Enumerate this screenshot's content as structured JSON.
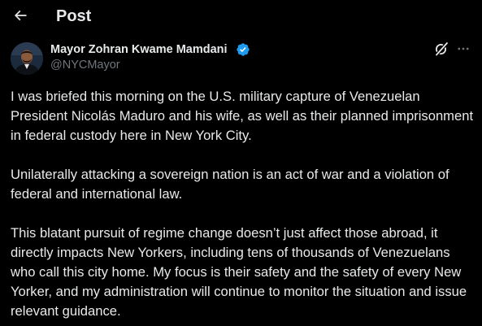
{
  "header": {
    "title": "Post"
  },
  "author": {
    "display_name": "Mayor Zohran Kwame Mamdani",
    "handle": "@NYCMayor",
    "verified": true,
    "verified_color": "#1d9bf0"
  },
  "post": {
    "paragraphs": [
      "I was briefed this morning on the U.S. military capture of Venezuelan President Nicolás Maduro and his wife, as well as their planned imprisonment in federal custody here in New York City.",
      "Unilaterally attacking a sovereign nation is an act of war and a violation of federal and international law.",
      "This blatant pursuit of regime change doesn’t just affect those abroad, it directly impacts New Yorkers, including tens of thousands of Venezuelans who call this city home. My focus is their safety and the safety of every New Yorker, and my administration will continue to monitor the situation and issue relevant guidance."
    ]
  },
  "icons": {
    "back": "arrow-left-icon",
    "verified": "verified-badge-icon",
    "grok": "grok-icon",
    "more": "more-horizontal-icon"
  },
  "colors": {
    "background": "#000000",
    "text": "#e7e9ea",
    "secondary_text": "#71767b"
  }
}
